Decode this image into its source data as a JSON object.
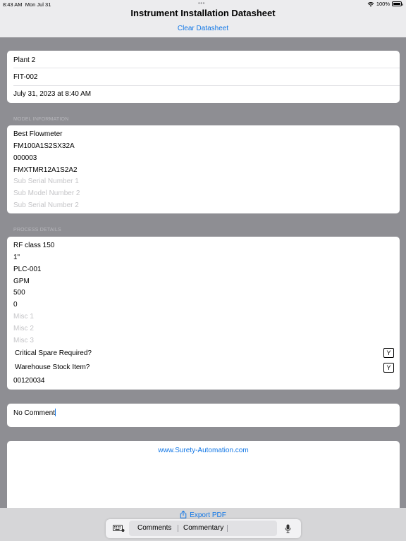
{
  "status_bar": {
    "time": "8:43 AM",
    "date": "Mon Jul 31",
    "battery": "100%",
    "icons": [
      "wifi-icon",
      "battery-icon"
    ]
  },
  "nav": {
    "title": "Instrument Installation Datasheet",
    "clear_label": "Clear Datasheet"
  },
  "header_card": {
    "plant": "Plant 2",
    "tag": "FIT-002",
    "datetime": "July 31, 2023 at 8:40 AM"
  },
  "model": {
    "section_label": "MODEL INFORMATION",
    "manufacturer": "Best Flowmeter",
    "model_number": "FM100A1S2SX32A",
    "serial_number": "000003",
    "sub_model": "FMXTMR12A1S2A2",
    "sub_serial_1_placeholder": "Sub Serial Number 1",
    "sub_model_2_placeholder": "Sub Model Number 2",
    "sub_serial_2_placeholder": "Sub Serial Number 2"
  },
  "process": {
    "section_label": "PROCESS DETAILS",
    "connection": "RF class 150",
    "size": "1\"",
    "controller": "PLC-001",
    "units": "GPM",
    "range_max": "500",
    "range_min": "0",
    "misc1_placeholder": "Misc 1",
    "misc2_placeholder": "Misc 2",
    "misc3_placeholder": "Misc 3",
    "critical_spare_label": "Critical Spare Required?",
    "critical_spare_value": "Y",
    "warehouse_label": "Warehouse Stock Item?",
    "warehouse_value": "Y",
    "stock_number": "00120034"
  },
  "comment": {
    "value": "No Comment"
  },
  "footer_card": {
    "website": "www.Surety-Automation.com"
  },
  "export_label": "Export PDF",
  "keyboard": {
    "suggestions": [
      "Comments",
      "Commentary",
      ""
    ],
    "icons": [
      "keyboard-icon",
      "mic-icon"
    ]
  },
  "colors": {
    "accent": "#1277e6",
    "background": "#8e8e93",
    "placeholder": "#c4c4c7"
  }
}
